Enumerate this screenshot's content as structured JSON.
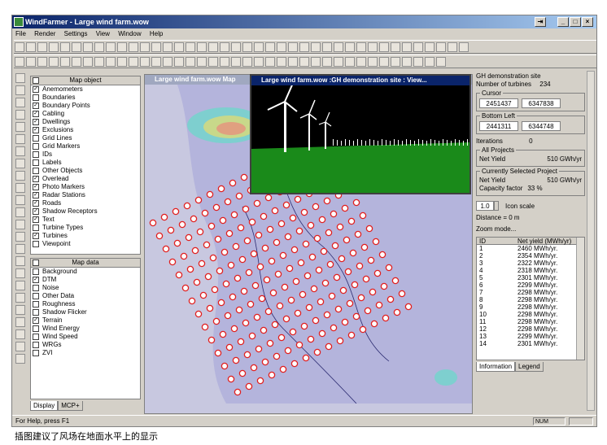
{
  "window": {
    "title": "WindFarmer - Large wind farm.wow",
    "controls": [
      "_",
      "□",
      "×"
    ],
    "extra_btn": "⇥"
  },
  "menu": [
    "File",
    "Render",
    "Settings",
    "View",
    "Window",
    "Help"
  ],
  "map_object_panel": {
    "header": "Map object",
    "items": [
      {
        "label": "Anemometers",
        "checked": true
      },
      {
        "label": "Boundaries",
        "checked": false
      },
      {
        "label": "Boundary Points",
        "checked": true
      },
      {
        "label": "Cabling",
        "checked": true
      },
      {
        "label": "Dwellings",
        "checked": true
      },
      {
        "label": "Exclusions",
        "checked": true
      },
      {
        "label": "Grid Lines",
        "checked": false
      },
      {
        "label": "Grid Markers",
        "checked": false
      },
      {
        "label": "IDs",
        "checked": false
      },
      {
        "label": "Labels",
        "checked": false
      },
      {
        "label": "Other Objects",
        "checked": false
      },
      {
        "label": "Overlead",
        "checked": true
      },
      {
        "label": "Photo Markers",
        "checked": true
      },
      {
        "label": "Radar Stations",
        "checked": true
      },
      {
        "label": "Roads",
        "checked": true
      },
      {
        "label": "Shadow Receptors",
        "checked": true
      },
      {
        "label": "Text",
        "checked": true
      },
      {
        "label": "Turbine Types",
        "checked": false
      },
      {
        "label": "Turbines",
        "checked": true
      },
      {
        "label": "Viewpoint",
        "checked": false
      }
    ]
  },
  "map_data_panel": {
    "header": "Map data",
    "items": [
      {
        "label": "Background",
        "checked": false
      },
      {
        "label": "DTM",
        "checked": true
      },
      {
        "label": "Noise",
        "checked": false
      },
      {
        "label": "Other Data",
        "checked": false
      },
      {
        "label": "Roughness",
        "checked": false
      },
      {
        "label": "Shadow Flicker",
        "checked": false
      },
      {
        "label": "Terrain",
        "checked": true
      },
      {
        "label": "Wind Energy",
        "checked": false
      },
      {
        "label": "Wind Speed",
        "checked": false
      },
      {
        "label": "WRGs",
        "checked": false
      },
      {
        "label": "ZVI",
        "checked": false
      }
    ]
  },
  "left_tabs": [
    "Display",
    "MCP+"
  ],
  "map_window": {
    "title": "Large wind farm.wow  Map"
  },
  "viewer_window": {
    "title": "Large wind farm.wow :GH demonstration site : View..."
  },
  "info": {
    "site": "GH demonstration site",
    "turbines_label": "Number of turbines",
    "turbines_value": "234",
    "cursor_label": "Cursor",
    "cursor_x": "2451437",
    "cursor_y": "6347838",
    "bottom_left_label": "Bottom Left",
    "bl_x": "2441311",
    "bl_y": "6344748",
    "iterations_label": "Iterations",
    "iterations_value": "0",
    "all_projects_label": "All Projects",
    "net_yield_label": "Net Yield",
    "net_yield_all": "510 GWh/yr",
    "current_label": "Currently Selected Project",
    "net_yield_current": "510 GWh/yr",
    "capacity_label": "Capacity factor",
    "capacity_value": "33 %",
    "icon_scale_value": "1.0",
    "icon_scale_label": "Icon scale",
    "distance": "Distance = 0 m",
    "zoom_mode": "Zoom mode..."
  },
  "yield_table": {
    "headers": [
      "ID",
      "Net yield (MWh/yr)"
    ],
    "rows": [
      [
        "1",
        "2460 MWh/yr."
      ],
      [
        "2",
        "2354 MWh/yr."
      ],
      [
        "3",
        "2322 MWh/yr."
      ],
      [
        "4",
        "2318 MWh/yr."
      ],
      [
        "5",
        "2301 MWh/yr."
      ],
      [
        "6",
        "2299 MWh/yr."
      ],
      [
        "7",
        "2298 MWh/yr."
      ],
      [
        "8",
        "2298 MWh/yr."
      ],
      [
        "9",
        "2298 MWh/yr."
      ],
      [
        "10",
        "2298 MWh/yr."
      ],
      [
        "11",
        "2298 MWh/yr."
      ],
      [
        "12",
        "2298 MWh/yr."
      ],
      [
        "13",
        "2299 MWh/yr."
      ],
      [
        "14",
        "2301 MWh/yr."
      ]
    ]
  },
  "right_tabs": [
    "Information",
    "Legend"
  ],
  "status": {
    "help": "For Help, press F1",
    "num": "NUM"
  },
  "caption": "插图建议了风场在地面水平上的显示",
  "colors": {
    "title_bar": "#0a246a",
    "sea": "#c8c8e0",
    "turbine_marker": "#e02020",
    "terrain_green": "#1a8a1a"
  }
}
